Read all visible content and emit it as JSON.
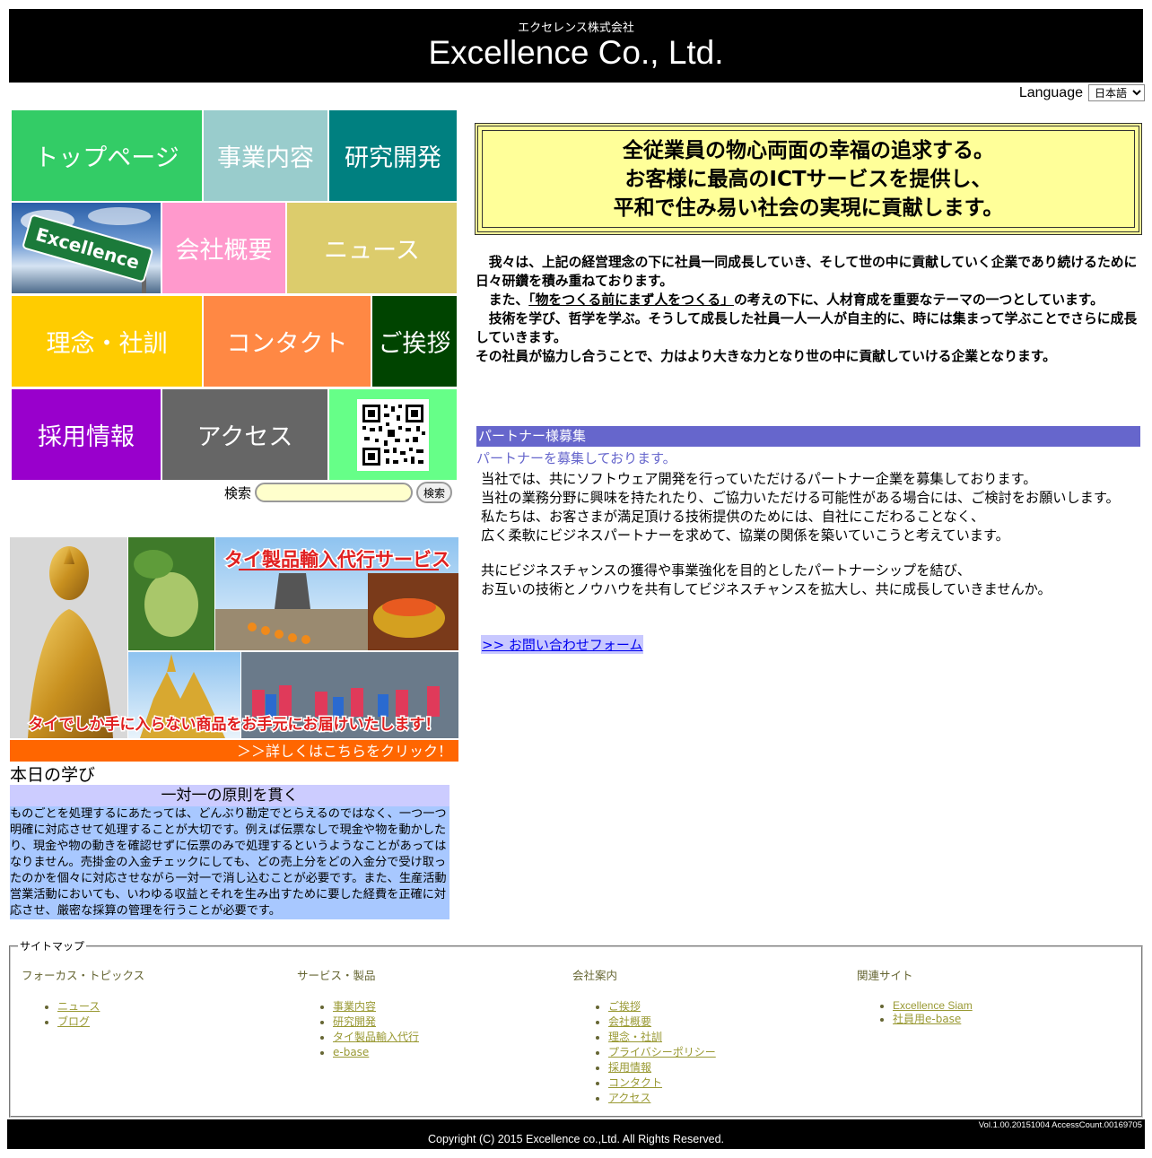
{
  "header": {
    "subtitle": "エクセレンス株式会社",
    "title": "Excellence Co., Ltd."
  },
  "language": {
    "label": "Language",
    "selected": "日本語"
  },
  "tiles": {
    "top": "トップページ",
    "business": "事業内容",
    "research": "研究開発",
    "excellence_sign": "Excellence",
    "company": "会社概要",
    "news": "ニュース",
    "philosophy": "理念・社訓",
    "contact": "コンタクト",
    "greeting": "ご挨拶",
    "recruit": "採用情報",
    "access": "アクセス"
  },
  "search": {
    "label": "検索",
    "button": "検索",
    "value": ""
  },
  "banner": {
    "title": "タイ製品輸入代行サービス",
    "caption": "タイでしか手に入らない商品をお手元にお届けいたします！",
    "click": "＞＞詳しくはこちらをクリック！"
  },
  "lesson": {
    "heading": "本日の学び",
    "title": "一対一の原則を貫く",
    "body": "ものごとを処理するにあたっては、どんぶり勘定でとらえるのではなく、一つ一つ明確に対応させて処理することが大切です。例えば伝票なしで現金や物を動かしたり、現金や物の動きを確認せずに伝票のみで処理するというようなことがあってはなりません。売掛金の入金チェックにしても、どの売上分をどの入金分で受け取ったのかを個々に対応させながら一対一で消し込むことが必要です。また、生産活動営業活動においても、いわゆる収益とそれを生み出すために要した経費を正確に対応させ、厳密な採算の管理を行うことが必要です。"
  },
  "motto": {
    "line1": "全従業員の物心両面の幸福の追求する。",
    "line2": "お客様に最高のICTサービスを提供し、",
    "line3": "平和で住み易い社会の実現に貢献します。"
  },
  "philosophy": {
    "p1": "　我々は、上記の経営理念の下に社員一同成長していき、そして世の中に貢献していく企業であり続けるために日々研鑽を積み重ねております。",
    "p2_pre": "　また、",
    "p2_quote": "「物をつくる前にまず人をつくる」",
    "p2_post": "の考えの下に、人材育成を重要なテーマの一つとしています。",
    "p3": "　技術を学び、哲学を学ぶ。そうして成長した社員一人一人が自主的に、時には集まって学ぶことでさらに成長していきます。",
    "p4": "その社員が協力し合うことで、力はより大きな力となり世の中に貢献していける企業となります。"
  },
  "partner": {
    "heading": "パートナー様募集",
    "subheading": "パートナーを募集しております。",
    "p1": "当社では、共にソフトウェア開発を行っていただけるパートナー企業を募集しております。",
    "p2": "当社の業務分野に興味を持たれたり、ご協力いただける可能性がある場合には、ご検討をお願いします。",
    "p3": "私たちは、お客さまが満足頂ける技術提供のためには、自社にこだわることなく、",
    "p4": "広く柔軟にビジネスパートナーを求めて、協業の関係を築いていこうと考えています。",
    "p5": "共にビジネスチャンスの獲得や事業強化を目的としたパートナーシップを結び、",
    "p6": "お互いの技術とノウハウを共有してビジネスチャンスを拡大し、共に成長していきませんか。",
    "link": ">> お問い合わせフォーム"
  },
  "sitemap": {
    "legend": "サイトマップ",
    "columns": [
      {
        "title": "フォーカス・トピックス",
        "items": [
          "ニュース",
          "ブログ"
        ]
      },
      {
        "title": "サービス・製品",
        "items": [
          "事業内容",
          "研究開発",
          "タイ製品輸入代行",
          "e-base"
        ]
      },
      {
        "title": "会社案内",
        "items": [
          "ご挨拶",
          "会社概要",
          "理念・社訓",
          "プライバシーポリシー",
          "採用情報",
          "コンタクト",
          "アクセス"
        ]
      },
      {
        "title": "関連サイト",
        "items": [
          "Excellence Siam",
          "社員用e-base"
        ]
      }
    ]
  },
  "footer": {
    "version": "Vol.1.00.20151004 AccessCount.00169705",
    "copyright": "Copyright (C) 2015 Excellence co.,Ltd. All Rights Reserved."
  },
  "colors": {
    "tile_top": "#33cc66",
    "tile_business": "#99cccc",
    "tile_research": "#008080",
    "tile_company": "#ff99cc",
    "tile_news": "#dccc6c",
    "tile_philosophy": "#ffcc00",
    "tile_contact": "#ff8844",
    "tile_greeting": "#004400",
    "tile_recruit": "#9900cc",
    "tile_access": "#666666",
    "tile_qr": "#66ff88",
    "partner_heading": "#6666cc",
    "motto_bg": "#ffff99"
  }
}
